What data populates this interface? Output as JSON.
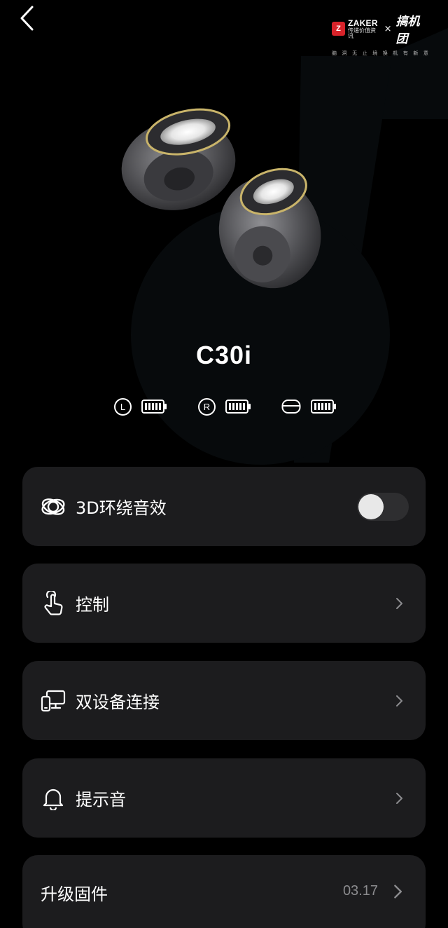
{
  "watermark": {
    "z_mark": "Z",
    "zaker_name": "ZAKER",
    "zaker_sub": "传递价值资讯",
    "times": "×",
    "brand": "搞机团",
    "tags": [
      "脑",
      "洞",
      "无",
      "止",
      "境",
      "换",
      "机",
      "有",
      "新",
      "意"
    ]
  },
  "device": {
    "name": "C30i",
    "battery": {
      "left_badge": "L",
      "right_badge": "R"
    }
  },
  "cards": {
    "surround": {
      "label": "3D环绕音效",
      "icon": "surround-sound-icon",
      "toggle_on": false
    },
    "control": {
      "label": "控制",
      "icon": "touch-gesture-icon"
    },
    "dual_device": {
      "label": "双设备连接",
      "icon": "dual-device-icon"
    },
    "prompt_tone": {
      "label": "提示音",
      "icon": "bell-icon"
    },
    "firmware": {
      "label": "升级固件",
      "value": "03.17"
    }
  },
  "colors": {
    "background": "#000000",
    "card": "#1c1c1e",
    "value_text": "#8b8b8e"
  }
}
